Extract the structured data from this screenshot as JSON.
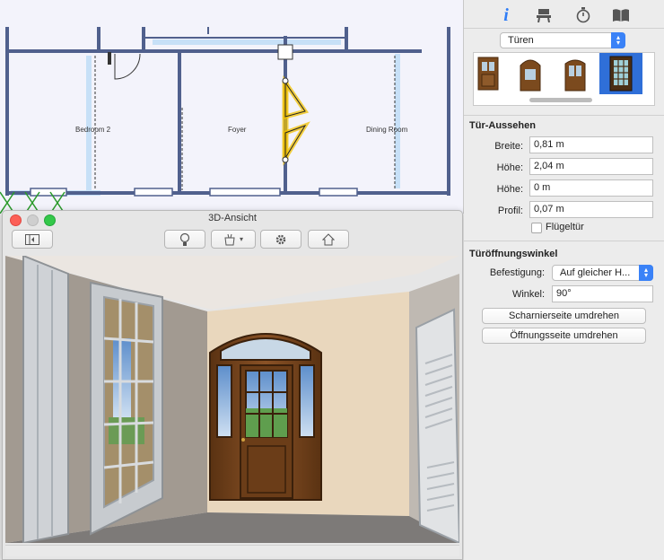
{
  "floorplan": {
    "rooms": [
      {
        "id": "bedroom",
        "label": "Bedroom 2"
      },
      {
        "id": "foyer",
        "label": "Foyer"
      },
      {
        "id": "dining",
        "label": "Dining Room"
      }
    ],
    "colors": {
      "background": "#f2f2fa",
      "wall": "#4f5f8c",
      "window": "#bfdcf5",
      "selection": "#f2c200"
    }
  },
  "view3d": {
    "title": "3D-Ansicht",
    "toolbar": {
      "sidebar_toggle": "sidebar-toggle-icon",
      "light": "light-bulb-icon",
      "furniture": "furniture-basket-icon",
      "settings": "gear-icon",
      "home": "home-icon"
    }
  },
  "inspector": {
    "tabs": [
      {
        "id": "info",
        "icon": "info-icon"
      },
      {
        "id": "furniture",
        "icon": "chair-icon"
      },
      {
        "id": "timer",
        "icon": "stopwatch-icon"
      },
      {
        "id": "library",
        "icon": "book-icon"
      }
    ],
    "category_select": "Türen",
    "thumbnails": [
      "door-thumbnail-1",
      "door-thumbnail-2",
      "door-thumbnail-3",
      "door-thumbnail-4"
    ],
    "appearance": {
      "title": "Tür-Aussehen",
      "fields": [
        {
          "label": "Breite:",
          "value": "0,81 m"
        },
        {
          "label": "Höhe:",
          "value": "2,04 m"
        },
        {
          "label": "Höhe:",
          "value": "0 m"
        },
        {
          "label": "Profil:",
          "value": "0,07 m"
        }
      ],
      "checkbox_label": "Flügeltür"
    },
    "opening": {
      "title": "Türöffnungswinkel",
      "mount_label": "Befestigung:",
      "mount_value": "Auf gleicher H...",
      "angle_label": "Winkel:",
      "angle_value": "90°",
      "flip_hinge": "Scharnierseite umdrehen",
      "flip_opening": "Öffnungsseite umdrehen"
    }
  }
}
